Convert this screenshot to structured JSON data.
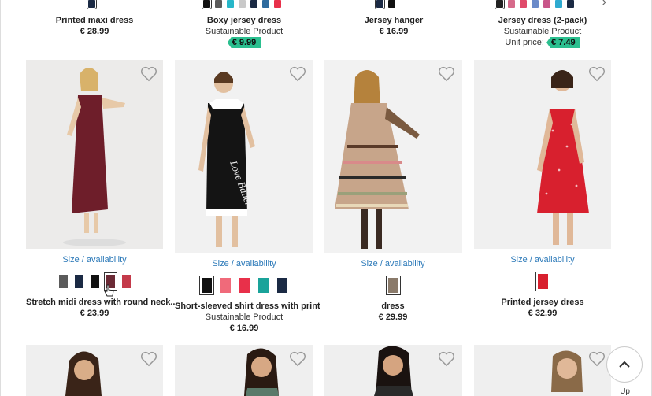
{
  "top_row": [
    {
      "name": "Printed maxi dress",
      "subtitle": "",
      "price": "€ 28.99",
      "sale": ""
    },
    {
      "name": "Boxy jersey dress",
      "subtitle": "Sustainable Product",
      "price": "",
      "sale": "€ 9.99"
    },
    {
      "name": "Jersey hanger",
      "subtitle": "",
      "price": "€ 16.99",
      "sale": ""
    },
    {
      "name": "Jersey dress (2-pack)",
      "subtitle": "Sustainable Product",
      "price": "Unit price:",
      "sale": "€ 7.49"
    }
  ],
  "products": [
    {
      "avail": "Size / availability",
      "name": "Stretch midi dress with round neck...",
      "subtitle": "",
      "price": "€ 23,99",
      "colors": [
        "#5b5b5b",
        "#1b2a44",
        "#111111",
        "#6b2a35",
        "#c43a4a"
      ],
      "selected": 3
    },
    {
      "avail": "Size / availability",
      "name": "Short-sleeved shirt dress with print",
      "subtitle": "Sustainable Product",
      "price": "€ 16.99",
      "colors": [
        "#111111",
        "#f06a7a",
        "#e8304a",
        "#1aa39a",
        "#1b2a44"
      ],
      "selected": 0
    },
    {
      "avail": "Size / availability",
      "name": "dress",
      "subtitle": "",
      "price": "€ 29.99",
      "colors": [
        "#8a7a6a"
      ],
      "selected": 0
    },
    {
      "avail": "Size / availability",
      "name": "Printed jersey dress",
      "subtitle": "",
      "price": "€ 32.99",
      "colors": [
        "#d8202e"
      ],
      "selected": 0
    }
  ],
  "icons": {
    "wishlist": "heart-outline-icon",
    "back_to_top": "chevron-up-icon",
    "next": "chevron-right-icon"
  },
  "back_to_top_label": "Up",
  "accent": {
    "link": "#2a78b8",
    "sale": "#2bbf8f"
  }
}
